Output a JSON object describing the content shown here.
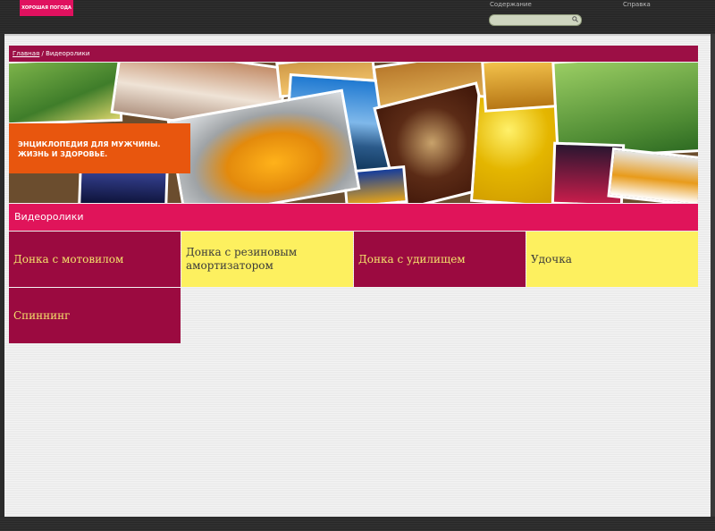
{
  "header": {
    "logo_text": "ХОРОШАЯ ПОГОДА",
    "nav_contents": "Содержание",
    "nav_help": "Справка",
    "search": {
      "placeholder": ""
    }
  },
  "breadcrumb": {
    "home": "Главная",
    "separator": " / ",
    "current": "Видеоролики"
  },
  "banner": {
    "tagline_line1": "ЭНЦИКЛОПЕДИЯ ДЛЯ МУЖЧИНЫ.",
    "tagline_line2": "ЖИЗНЬ И ЗДОРОВЬЕ."
  },
  "section": {
    "title": "Видеоролики"
  },
  "videos": [
    {
      "label": "Донка с мотовилом"
    },
    {
      "label": "Донка с резиновым амортизатором"
    },
    {
      "label": "Донка с удилищем"
    },
    {
      "label": "Удочка"
    },
    {
      "label": "Спиннинг"
    }
  ],
  "colors": {
    "accent_pink": "#e0145a",
    "tile_dark": "#9b0a40",
    "tile_light": "#fdf05f",
    "banner_orange": "#e8560e"
  }
}
